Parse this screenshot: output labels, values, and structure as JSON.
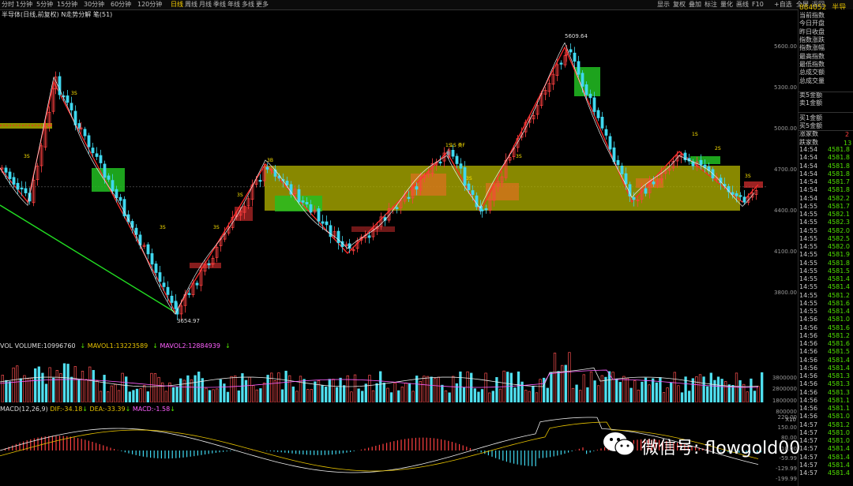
{
  "toolbar": {
    "tabs": [
      "分时",
      "1分钟",
      "5分钟",
      "15分钟",
      "30分钟",
      "60分钟",
      "120分钟",
      "日线",
      "周线",
      "月线",
      "季线",
      "年线",
      "多线",
      "更多"
    ],
    "active_tab": "日线",
    "right_tools": [
      "显示",
      "复权",
      "叠加",
      "标注",
      "量化",
      "画线",
      "F10",
      "+自选",
      "全屏",
      "返回"
    ]
  },
  "header": {
    "code": "884052",
    "name": "半导体"
  },
  "subtitle": "半导体(日线,前复权) N走势分解 笔(51)",
  "main_chart": {
    "price_ticks": [
      "5600.00",
      "5300.00",
      "5000.00",
      "4700.00",
      "4400.00",
      "4100.00",
      "3800.00"
    ],
    "high_label": "5609.64",
    "low_label": "3654.97",
    "marks": [
      "3S",
      "3S",
      "3S",
      "3S",
      "3B",
      "3S",
      "1S",
      "1S 类F",
      "3S",
      "3S",
      "1S",
      "2S",
      "3S"
    ]
  },
  "volume": {
    "label": "VOL VOLUME:10996760",
    "mavol1": "MAVOL1:13223589",
    "mavol2": "MAVOL2:12884939",
    "ticks": [
      "3800000",
      "2800000",
      "1800000",
      "800000"
    ],
    "unit": "X10",
    "colors": {
      "up": "#ff5050",
      "down": "#50e0f0",
      "mavol1": "#e8e8e8",
      "mavol2": "#ff60ff"
    }
  },
  "macd": {
    "label": "MACD(12,26,9)",
    "dif": "DIF:-34.18",
    "dea": "DEA:-33.39",
    "macd": "MACD:-1.58",
    "ticks": [
      "220.00",
      "150.00",
      "80.00",
      "10.00",
      "-59.99",
      "-129.99",
      "-199.99"
    ]
  },
  "right_panel": {
    "labels": [
      "当前指数",
      "今日开盘",
      "昨日收盘",
      "指数涨跌",
      "指数涨幅",
      "最高指数",
      "最低指数",
      "总成交额",
      "总成交量",
      "卖5金额",
      "卖1金额",
      "买1金额",
      "买5金额",
      "涨家数",
      "跌家数"
    ],
    "up_count_partial": "2",
    "down_count_partial": "13",
    "ticks": [
      {
        "time": "14:54",
        "value": "4581.8"
      },
      {
        "time": "14:54",
        "value": "4581.8"
      },
      {
        "time": "14:54",
        "value": "4581.8"
      },
      {
        "time": "14:54",
        "value": "4581.8"
      },
      {
        "time": "14:54",
        "value": "4581.7"
      },
      {
        "time": "14:54",
        "value": "4581.8"
      },
      {
        "time": "14:54",
        "value": "4582.2"
      },
      {
        "time": "14:55",
        "value": "4581.7"
      },
      {
        "time": "14:55",
        "value": "4582.1"
      },
      {
        "time": "14:55",
        "value": "4582.3"
      },
      {
        "time": "14:55",
        "value": "4582.0"
      },
      {
        "time": "14:55",
        "value": "4582.5"
      },
      {
        "time": "14:55",
        "value": "4582.0"
      },
      {
        "time": "14:55",
        "value": "4581.9"
      },
      {
        "time": "14:55",
        "value": "4581.8"
      },
      {
        "time": "14:55",
        "value": "4581.5"
      },
      {
        "time": "14:55",
        "value": "4581.4"
      },
      {
        "time": "14:55",
        "value": "4581.4"
      },
      {
        "time": "14:55",
        "value": "4581.2"
      },
      {
        "time": "14:55",
        "value": "4581.6"
      },
      {
        "time": "14:55",
        "value": "4581.4"
      },
      {
        "time": "14:56",
        "value": "4581.0"
      },
      {
        "time": "14:56",
        "value": "4581.6"
      },
      {
        "time": "14:56",
        "value": "4581.2"
      },
      {
        "time": "14:56",
        "value": "4581.6"
      },
      {
        "time": "14:56",
        "value": "4581.5"
      },
      {
        "time": "14:56",
        "value": "4581.4"
      },
      {
        "time": "14:56",
        "value": "4581.4"
      },
      {
        "time": "14:56",
        "value": "4581.3"
      },
      {
        "time": "14:56",
        "value": "4581.3"
      },
      {
        "time": "14:56",
        "value": "4581.3"
      },
      {
        "time": "14:56",
        "value": "4581.1"
      },
      {
        "time": "14:56",
        "value": "4581.1"
      },
      {
        "time": "14:56",
        "value": "4581.0"
      },
      {
        "time": "14:57",
        "value": "4581.2"
      },
      {
        "time": "14:57",
        "value": "4581.0"
      },
      {
        "time": "14:57",
        "value": "4581.0"
      },
      {
        "time": "14:57",
        "value": "4581.4"
      },
      {
        "time": "14:57",
        "value": "4581.4"
      },
      {
        "time": "14:57",
        "value": "4581.4"
      },
      {
        "time": "14:57",
        "value": "4581.4"
      }
    ]
  },
  "watermark": {
    "text": "微信号: flowgold00",
    "icon": "wechat-icon"
  }
}
